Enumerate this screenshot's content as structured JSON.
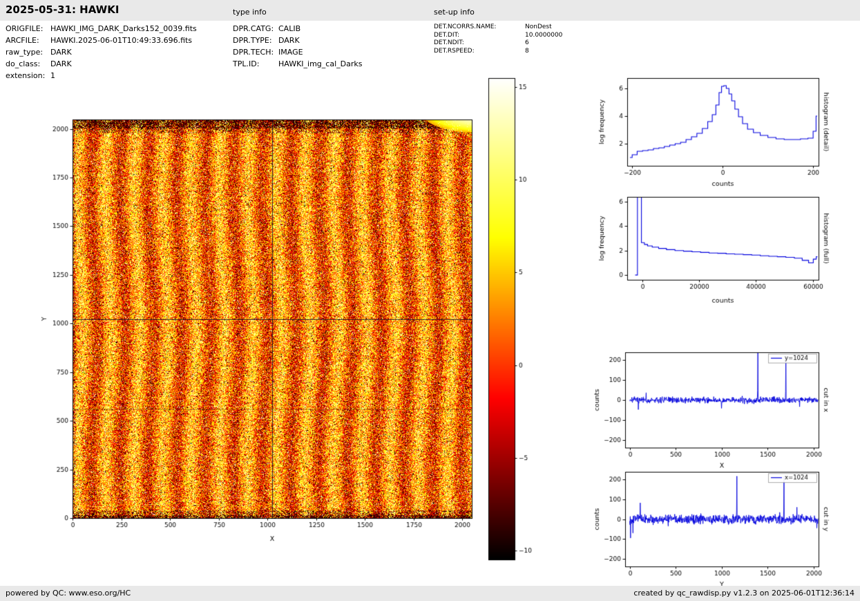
{
  "header": {
    "title": "2025-05-31: HAWKI",
    "type_info_label": "type info",
    "setup_info_label": "set-up info"
  },
  "metadata": {
    "left": [
      {
        "label": "ORIGFILE:",
        "value": "HAWKI_IMG_DARK_Darks152_0039.fits"
      },
      {
        "label": "ARCFILE:",
        "value": "HAWKI.2025-06-01T10:49:33.696.fits"
      },
      {
        "label": "raw_type:",
        "value": "DARK"
      },
      {
        "label": "do_class:",
        "value": "DARK"
      },
      {
        "label": "extension:",
        "value": "1"
      }
    ],
    "middle": [
      {
        "label": "DPR.CATG:",
        "value": "CALIB"
      },
      {
        "label": "DPR.TYPE:",
        "value": "DARK"
      },
      {
        "label": "DPR.TECH:",
        "value": "IMAGE"
      },
      {
        "label": "TPL.ID:",
        "value": "HAWKI_img_cal_Darks"
      }
    ],
    "right": [
      {
        "label": "DET.NCORRS.NAME:",
        "value": "NonDest"
      },
      {
        "label": "DET.DIT:",
        "value": "10.0000000"
      },
      {
        "label": "DET.NDIT:",
        "value": "6"
      },
      {
        "label": "DET.RSPEED:",
        "value": "8"
      }
    ]
  },
  "footer": {
    "left": "powered by QC: www.eso.org/HC",
    "right": "created by qc_rawdisp.py v1.2.3 on 2025-06-01T12:36:14"
  },
  "colors": {
    "plot_line": "#0000dd",
    "bar_background": "#e9e9e9",
    "axis": "#000000"
  },
  "chart_data": [
    {
      "id": "detector_image",
      "type": "heatmap",
      "xlabel": "X",
      "ylabel": "Y",
      "x_range": [
        0,
        2048
      ],
      "y_range": [
        0,
        2048
      ],
      "x_ticks": [
        0,
        250,
        500,
        750,
        1000,
        1250,
        1500,
        1750,
        2000
      ],
      "y_ticks": [
        0,
        250,
        500,
        750,
        1000,
        1250,
        1500,
        1750,
        2000
      ],
      "colormap": "hot",
      "colorbar": {
        "ticks": [
          15,
          10,
          5,
          0,
          -5,
          -10
        ],
        "range": [
          -10.5,
          15.5
        ]
      },
      "crosshair": {
        "x": 1024,
        "y": 1024
      },
      "faint_line_y": 560,
      "features": {
        "stripe_count": 14,
        "dark_speckle_fraction": 0.045,
        "bright_speckle_fraction": 0.04,
        "dark_top_rows": true,
        "dark_bottom_rows": true,
        "bright_blob_top_right": true
      }
    },
    {
      "id": "histogram_detail",
      "type": "line",
      "style": "step",
      "right_label": "histogram (detail)",
      "xlabel": "counts",
      "ylabel": "log frequency",
      "x_ticks": [
        -200,
        0,
        200
      ],
      "y_ticks": [
        2,
        4,
        6
      ],
      "x_range": [
        -211,
        212
      ],
      "y_range": [
        0.4,
        6.75
      ],
      "points": [
        [
          -205,
          1.0
        ],
        [
          -195,
          1.2
        ],
        [
          -183,
          1.45
        ],
        [
          -171,
          1.5
        ],
        [
          -159,
          1.55
        ],
        [
          -147,
          1.65
        ],
        [
          -135,
          1.7
        ],
        [
          -123,
          1.8
        ],
        [
          -111,
          1.9
        ],
        [
          -99,
          2.0
        ],
        [
          -87,
          2.1
        ],
        [
          -75,
          2.3
        ],
        [
          -63,
          2.5
        ],
        [
          -51,
          2.75
        ],
        [
          -39,
          3.1
        ],
        [
          -27,
          3.6
        ],
        [
          -19,
          4.1
        ],
        [
          -11,
          4.8
        ],
        [
          -5,
          5.7
        ],
        [
          0,
          6.15
        ],
        [
          5,
          6.2
        ],
        [
          11,
          6.0
        ],
        [
          17,
          5.6
        ],
        [
          23,
          5.1
        ],
        [
          31,
          4.5
        ],
        [
          39,
          3.95
        ],
        [
          49,
          3.45
        ],
        [
          61,
          3.05
        ],
        [
          75,
          2.8
        ],
        [
          91,
          2.6
        ],
        [
          109,
          2.45
        ],
        [
          127,
          2.35
        ],
        [
          145,
          2.3
        ],
        [
          163,
          2.3
        ],
        [
          181,
          2.35
        ],
        [
          196,
          2.4
        ],
        [
          204,
          2.9
        ],
        [
          209,
          4.0
        ]
      ]
    },
    {
      "id": "histogram_full",
      "type": "line",
      "style": "step",
      "right_label": "histogram (full)",
      "xlabel": "counts",
      "ylabel": "log frequency",
      "x_ticks": [
        0,
        20000,
        40000,
        60000
      ],
      "y_ticks": [
        0,
        2,
        4,
        6
      ],
      "x_range": [
        -5300,
        62000
      ],
      "y_range": [
        -0.39,
        6.4
      ],
      "points": [
        [
          -2500,
          0.0
        ],
        [
          -900,
          6.6
        ],
        [
          300,
          2.65
        ],
        [
          1200,
          2.5
        ],
        [
          2500,
          2.38
        ],
        [
          4500,
          2.28
        ],
        [
          7000,
          2.18
        ],
        [
          10000,
          2.08
        ],
        [
          13000,
          2.0
        ],
        [
          16000,
          1.95
        ],
        [
          19000,
          1.9
        ],
        [
          22000,
          1.85
        ],
        [
          25000,
          1.8
        ],
        [
          28000,
          1.78
        ],
        [
          31000,
          1.73
        ],
        [
          34000,
          1.7
        ],
        [
          37000,
          1.67
        ],
        [
          40000,
          1.63
        ],
        [
          43000,
          1.58
        ],
        [
          46000,
          1.53
        ],
        [
          49000,
          1.5
        ],
        [
          52000,
          1.45
        ],
        [
          55000,
          1.38
        ],
        [
          57500,
          1.2
        ],
        [
          59500,
          1.0
        ],
        [
          60800,
          1.3
        ],
        [
          61600,
          1.5
        ]
      ]
    },
    {
      "id": "cut_in_x",
      "type": "line",
      "style": "noise",
      "legend": "y=1024",
      "right_label": "cut in x",
      "xlabel": "X",
      "ylabel": "counts",
      "x_ticks": [
        0,
        500,
        1000,
        1500,
        2000
      ],
      "y_ticks": [
        -200,
        -100,
        0,
        100,
        200
      ],
      "x_range": [
        -50,
        2055
      ],
      "y_range": [
        -238,
        238
      ],
      "n_points": 700,
      "noise_amplitude": 11,
      "spikes": [
        {
          "x": 95,
          "y": -48
        },
        {
          "x": 1000,
          "y": -42
        },
        {
          "x": 1395,
          "y": 236
        },
        {
          "x": 1700,
          "y": 212
        }
      ]
    },
    {
      "id": "cut_in_y",
      "type": "line",
      "style": "noise",
      "legend": "x=1024",
      "right_label": "cut in y",
      "xlabel": "Y",
      "ylabel": "counts",
      "x_ticks": [
        0,
        500,
        1000,
        1500,
        2000
      ],
      "y_ticks": [
        -200,
        -100,
        0,
        100,
        200
      ],
      "x_range": [
        -50,
        2055
      ],
      "y_range": [
        -238,
        238
      ],
      "n_points": 700,
      "noise_amplitude": 16,
      "spikes": [
        {
          "x": 8,
          "y": -95
        },
        {
          "x": 35,
          "y": -70
        },
        {
          "x": 115,
          "y": 82
        },
        {
          "x": 1165,
          "y": 216
        },
        {
          "x": 1680,
          "y": 216
        },
        {
          "x": 1820,
          "y": 60
        },
        {
          "x": 2035,
          "y": -45
        }
      ]
    }
  ]
}
